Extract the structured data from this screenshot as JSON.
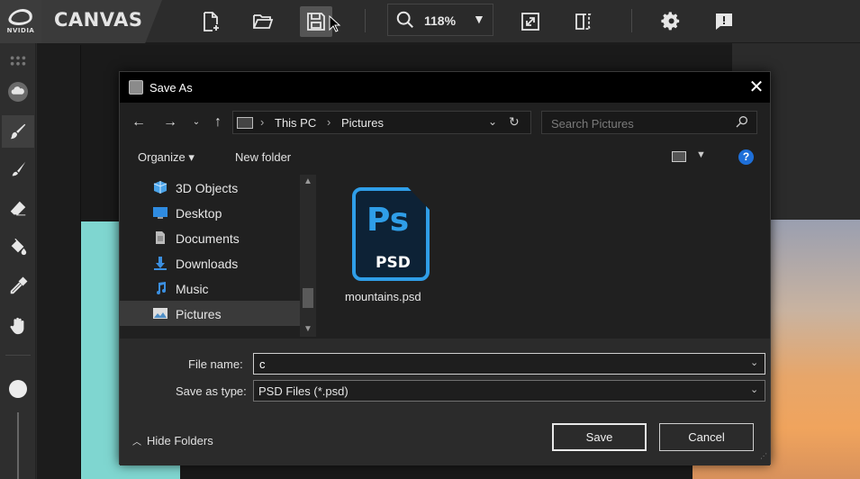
{
  "app": {
    "logo_text": "NVIDIA",
    "brand": "CANVAS",
    "zoom_level": "118%",
    "colors": {
      "topbar": "#2c2c2c",
      "accent_blue": "#2f9ee8",
      "canvas_cyan": "#7fd6d0"
    },
    "toolbar_icons": [
      "new-file-icon",
      "open-folder-icon",
      "save-icon",
      "zoom-icon",
      "fit-screen-icon",
      "split-view-icon",
      "gear-icon",
      "feedback-icon"
    ],
    "tools": [
      "layers-icon",
      "cloud-icon",
      "brush-icon",
      "paintbrush-icon",
      "eraser-icon",
      "fill-bucket-icon",
      "eyedropper-icon",
      "pan-hand-icon"
    ]
  },
  "dialog": {
    "title": "Save As",
    "close_label": "✕",
    "breadcrumb": [
      "This PC",
      "Pictures"
    ],
    "search_placeholder": "Search Pictures",
    "commands": {
      "organize": "Organize ▾",
      "new_folder": "New folder"
    },
    "help_label": "?",
    "nav_items": [
      {
        "label": "3D Objects",
        "icon": "3d-objects-icon"
      },
      {
        "label": "Desktop",
        "icon": "desktop-icon"
      },
      {
        "label": "Documents",
        "icon": "documents-icon"
      },
      {
        "label": "Downloads",
        "icon": "downloads-icon"
      },
      {
        "label": "Music",
        "icon": "music-icon"
      },
      {
        "label": "Pictures",
        "icon": "pictures-icon",
        "selected": true
      }
    ],
    "files": [
      {
        "name": "mountains.psd",
        "badge_top": "Ps",
        "badge_bottom": "PSD"
      }
    ],
    "file_name_label": "File name:",
    "file_name_value": "c",
    "save_type_label": "Save as type:",
    "save_type_value": "PSD Files (*.psd)",
    "hide_folders": "Hide Folders",
    "save_button": "Save",
    "cancel_button": "Cancel"
  }
}
